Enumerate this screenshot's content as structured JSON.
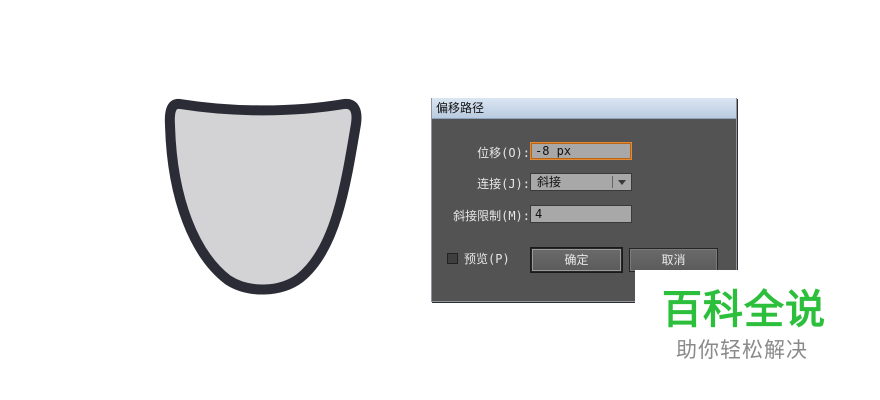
{
  "canvas": {
    "shape": {
      "fill_color": "#d3d3d6",
      "stroke_color": "#2b2c36"
    }
  },
  "dialog": {
    "title": "偏移路径",
    "offset": {
      "label": "位移(O):",
      "value": "-8 px"
    },
    "joins": {
      "label": "连接(J):",
      "selected": "斜接"
    },
    "miter_limit": {
      "label": "斜接限制(M):",
      "value": "4"
    },
    "preview": {
      "label": "预览(P)",
      "checked": false
    },
    "ok_label": "确定",
    "cancel_label": "取消"
  },
  "watermark": {
    "title": "百科全说",
    "subtitle": "助你轻松解决",
    "title_color": "#2cbf3c",
    "subtitle_color": "#8a8a8a"
  }
}
